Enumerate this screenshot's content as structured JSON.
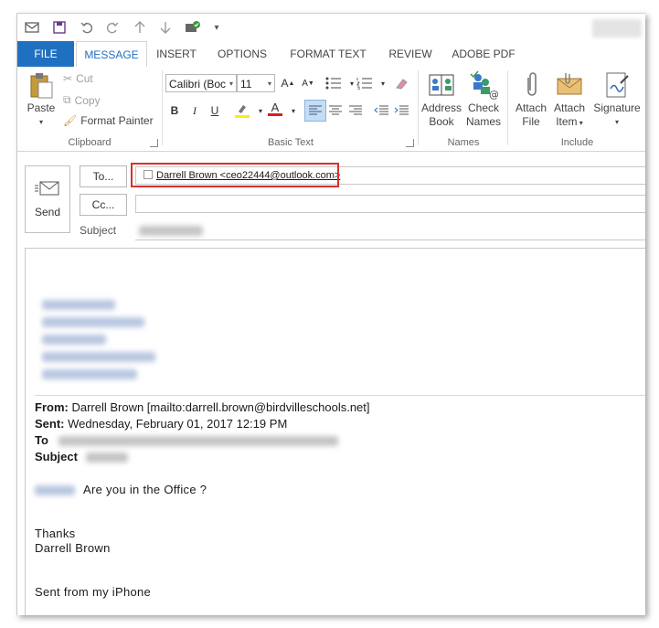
{
  "quick_access": {
    "icons": [
      "email-icon",
      "save-icon",
      "undo-icon",
      "redo-icon",
      "up-arrow-icon",
      "down-arrow-icon",
      "touch-mode-icon",
      "customize-icon"
    ]
  },
  "tabs": [
    "FILE",
    "MESSAGE",
    "INSERT",
    "OPTIONS",
    "FORMAT TEXT",
    "REVIEW",
    "ADOBE PDF"
  ],
  "ribbon": {
    "clipboard": {
      "paste": "Paste",
      "cut": "Cut",
      "copy": "Copy",
      "format_painter": "Format Painter",
      "label": "Clipboard"
    },
    "basic_text": {
      "font": "Calibri (Boc",
      "size": "11",
      "bold": "B",
      "italic": "I",
      "underline": "U",
      "grow": "A",
      "shrink": "A",
      "font_color": "A",
      "label": "Basic Text"
    },
    "names": {
      "address_book": "Address",
      "address_book_2": "Book",
      "check_names": "Check",
      "check_names_2": "Names",
      "label": "Names"
    },
    "include": {
      "attach_file": "Attach",
      "attach_file_2": "File",
      "attach_item": "Attach",
      "attach_item_2": "Item",
      "signature": "Signature",
      "label": "Include"
    }
  },
  "compose": {
    "send": "Send",
    "to_button": "To...",
    "cc_button": "Cc...",
    "subject_label": "Subject",
    "to_recipient": "Darrell Brown <ceo22444@outlook.com>"
  },
  "message": {
    "from_label": "From:",
    "from_value": " Darrell Brown [mailto:darrell.brown@birdvilleschools.net]",
    "sent_label": "Sent:",
    "sent_value": " Wednesday, February 01, 2017 12:19 PM",
    "to_label": "To",
    "subject_label": "Subject",
    "question": "Are you in the Office ?",
    "thanks": "Thanks",
    "signature_name": "Darrell Brown",
    "sent_from": "Sent from my iPhone"
  },
  "colors": {
    "accent": "#1f70c1",
    "highlight_border": "#d8302a"
  }
}
